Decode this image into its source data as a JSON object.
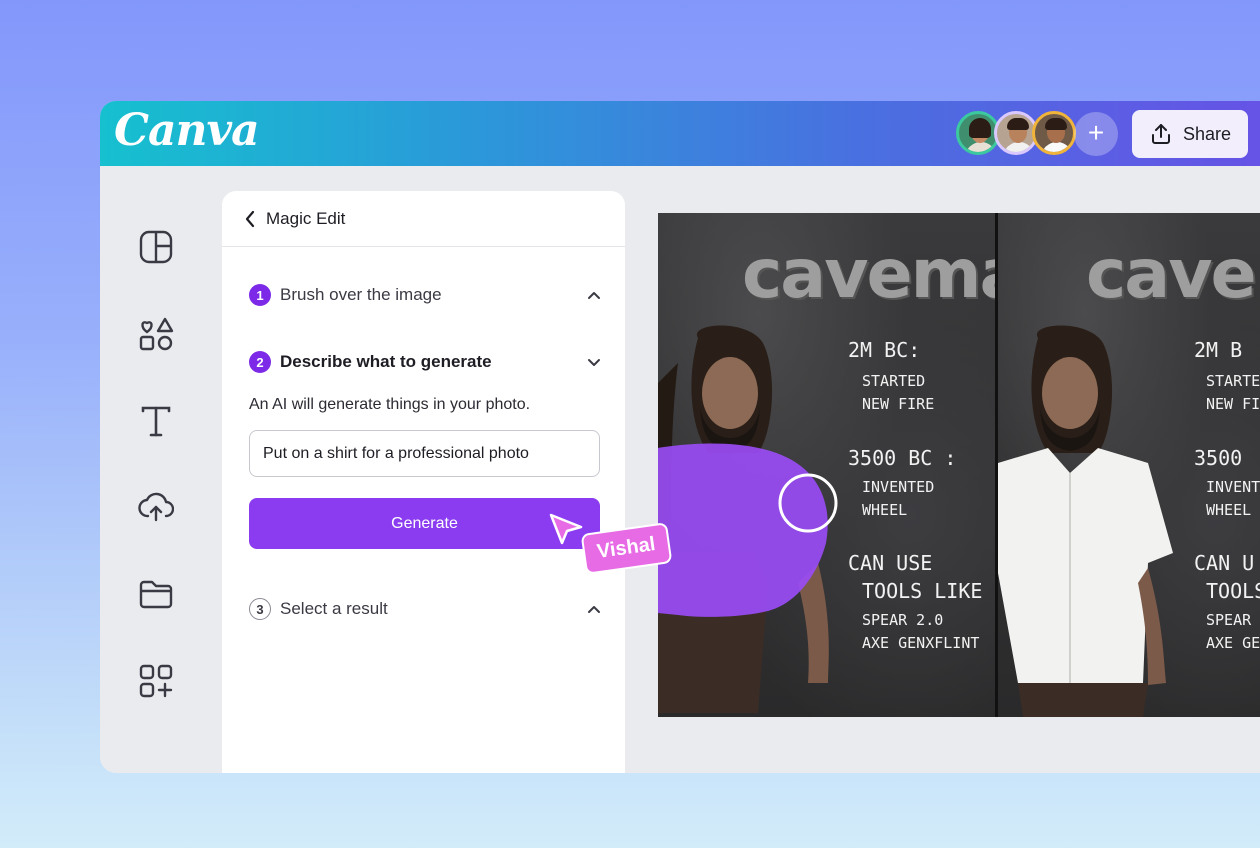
{
  "brand": {
    "logo_text": "Canva"
  },
  "header": {
    "share_label": "Share",
    "collaborators": [
      "avatar-1",
      "avatar-2",
      "avatar-3"
    ],
    "accent_gradient": [
      "#16c0cf",
      "#6752e6"
    ]
  },
  "sidebar": {
    "icons": [
      "design-icon",
      "elements-icon",
      "text-icon",
      "uploads-icon",
      "projects-icon",
      "apps-icon"
    ]
  },
  "panel": {
    "title": "Magic Edit",
    "steps": [
      {
        "num": "1",
        "label": "Brush over the image"
      },
      {
        "num": "2",
        "label": "Describe what to generate"
      },
      {
        "num": "3",
        "label": "Select a result"
      }
    ],
    "description": "An AI will generate things in your photo.",
    "prompt_value": "Put on a shirt for a professional photo",
    "generate_label": "Generate"
  },
  "cursor": {
    "name": "Vishal"
  },
  "design": {
    "title": "caveman",
    "facts": [
      {
        "head": "2M BC:",
        "lines": [
          "STARTED",
          "NEW FIRE"
        ]
      },
      {
        "head": "3500 BC :",
        "lines": [
          "INVENTED",
          "WHEEL"
        ]
      },
      {
        "head": "CAN USE",
        "lines": [
          "TOOLS LIKE",
          "SPEAR 2.0",
          "AXE GENXFLINT"
        ]
      }
    ],
    "right_title": "caveme",
    "right_facts": [
      {
        "head": "2M B",
        "lines": [
          "STARTE",
          "NEW FI"
        ]
      },
      {
        "head": "3500",
        "lines": [
          "INVENTE",
          "WHEEL"
        ]
      },
      {
        "head": "CAN U",
        "lines": [
          "TOOLS",
          "SPEAR",
          "AXE GE"
        ]
      }
    ],
    "brush_color": "#9a4cf5",
    "accent": "#8b3cf0"
  }
}
